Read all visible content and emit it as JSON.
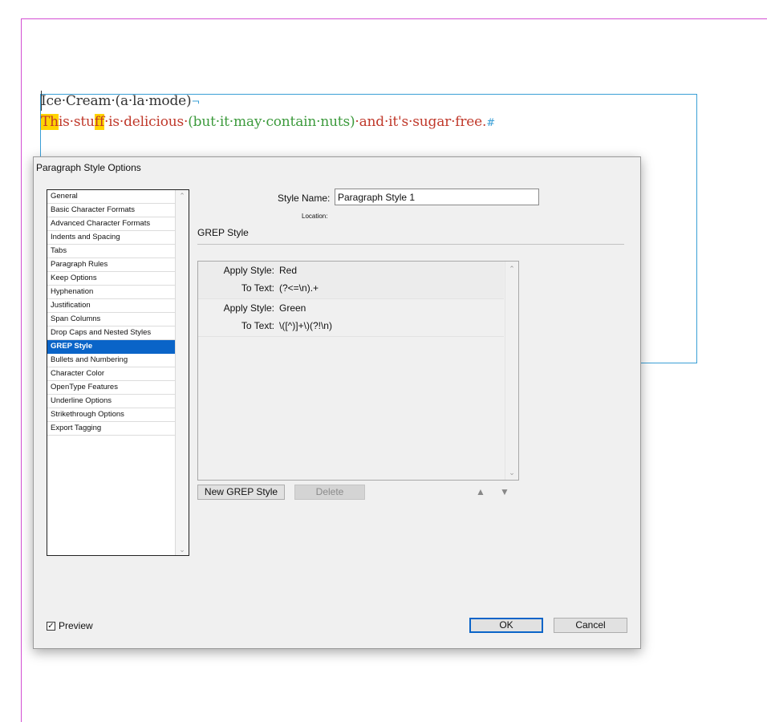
{
  "document": {
    "line1": "Ice·Cream·(a·la·mode)",
    "line1_mark": "¬",
    "line2": {
      "hl1": "Th",
      "part1": "is·stu",
      "hl2": "ff",
      "part2": "·is·delicious·",
      "part3": "(but·it·may·contain·nuts)",
      "part4": "·and·it's·sugar·free.",
      "end_mark": "#"
    }
  },
  "dialog": {
    "title": "Paragraph Style Options",
    "categories": [
      "General",
      "Basic Character Formats",
      "Advanced Character Formats",
      "Indents and Spacing",
      "Tabs",
      "Paragraph Rules",
      "Keep Options",
      "Hyphenation",
      "Justification",
      "Span Columns",
      "Drop Caps and Nested Styles",
      "GREP Style",
      "Bullets and Numbering",
      "Character Color",
      "OpenType Features",
      "Underline Options",
      "Strikethrough Options",
      "Export Tagging"
    ],
    "selected_category": "GREP Style",
    "style_name_label": "Style Name:",
    "style_name_value": "Paragraph Style 1",
    "location_label": "Location:",
    "section_title": "GREP Style",
    "grep_entries": [
      {
        "apply_label": "Apply Style:",
        "style": "Red",
        "to_text_label": "To Text:",
        "expression": "(?<=\\n).+"
      },
      {
        "apply_label": "Apply Style:",
        "style": "Green",
        "to_text_label": "To Text:",
        "expression": "\\([^)]+\\)(?!\\n)"
      }
    ],
    "new_grep_button": "New GREP Style",
    "delete_button": "Delete",
    "preview_label": "Preview",
    "preview_checked": true,
    "ok_button": "OK",
    "cancel_button": "Cancel"
  },
  "colors": {
    "selection_blue": "#0a64c8",
    "red_style": "#c0392b",
    "green_style": "#3c9a3c",
    "highlight_yellow": "#ffd400",
    "frame_blue": "#3a9fd6",
    "margin_magenta": "#d34fd3"
  }
}
